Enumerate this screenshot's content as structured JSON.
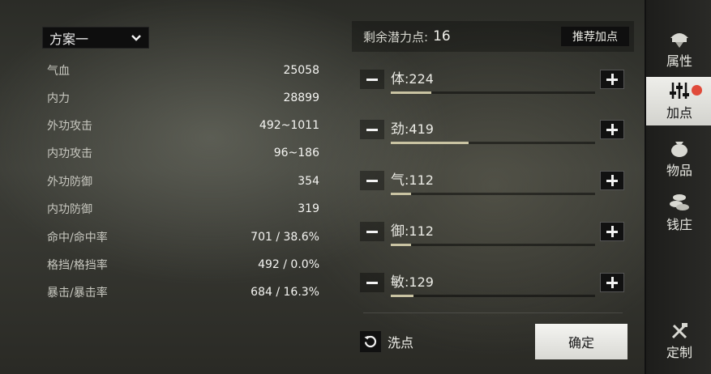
{
  "plan": {
    "selected": "方案一"
  },
  "stats": [
    {
      "label": "气血",
      "value": "25058"
    },
    {
      "label": "内力",
      "value": "28899"
    },
    {
      "label": "外功攻击",
      "value": "492~1011"
    },
    {
      "label": "内功攻击",
      "value": "96~186"
    },
    {
      "label": "外功防御",
      "value": "354"
    },
    {
      "label": "内功防御",
      "value": "319"
    },
    {
      "label": "命中/命中率",
      "value": "701 / 38.6%"
    },
    {
      "label": "格挡/格挡率",
      "value": "492 / 0.0%"
    },
    {
      "label": "暴击/暴击率",
      "value": "684 / 16.3%"
    }
  ],
  "potential": {
    "label": "剩余潜力点:",
    "value": "16",
    "recommend_label": "推荐加点"
  },
  "attributes": [
    {
      "name": "体",
      "sep": ":",
      "value": "224",
      "level": 0.2
    },
    {
      "name": "劲",
      "sep": ":",
      "value": "419",
      "level": 0.38
    },
    {
      "name": "气",
      "sep": ":",
      "value": "112",
      "level": 0.1
    },
    {
      "name": "御",
      "sep": ":",
      "value": "112",
      "level": 0.1
    },
    {
      "name": "敏",
      "sep": ":",
      "value": "129",
      "level": 0.11
    }
  ],
  "actions": {
    "wash_label": "洗点",
    "confirm_label": "确定"
  },
  "sidebar": [
    {
      "label": "属性",
      "icon": "helmet-icon"
    },
    {
      "label": "加点",
      "icon": "sliders-icon",
      "active": true
    },
    {
      "label": "物品",
      "icon": "bag-icon"
    },
    {
      "label": "钱庄",
      "icon": "coins-icon"
    },
    {
      "label": "定制",
      "icon": "tools-icon"
    }
  ],
  "colors": {
    "accent_fill": "#c9c3a2",
    "badge": "#e04a3a"
  }
}
